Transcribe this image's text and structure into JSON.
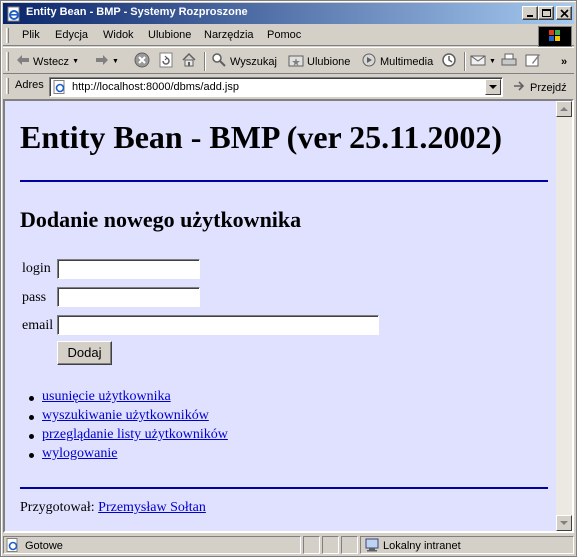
{
  "window": {
    "title": "Entity Bean - BMP - Systemy Rozproszone"
  },
  "menu": {
    "items": [
      {
        "label": "Plik"
      },
      {
        "label": "Edycja"
      },
      {
        "label": "Widok"
      },
      {
        "label": "Ulubione"
      },
      {
        "label": "Narzędzia"
      },
      {
        "label": "Pomoc"
      }
    ]
  },
  "toolbar": {
    "back_label": "Wstecz",
    "search_label": "Wyszukaj",
    "favorites_label": "Ulubione",
    "media_label": "Multimedia",
    "overflow": "»"
  },
  "address": {
    "label": "Adres",
    "url": "http://localhost:8000/dbms/add.jsp",
    "go_label": "Przejdź"
  },
  "page": {
    "heading": "Entity Bean - BMP (ver 25.11.2002)",
    "subheading": "Dodanie nowego użytkownika",
    "form": {
      "login_label": "login",
      "login_value": "",
      "pass_label": "pass",
      "pass_value": "",
      "email_label": "email",
      "email_value": "",
      "submit_label": "Dodaj"
    },
    "links": [
      {
        "label": "usunięcie użytkownika"
      },
      {
        "label": "wyszukiwanie użytkowników"
      },
      {
        "label": "przeglądanie listy użytkowników"
      },
      {
        "label": "wylogowanie"
      }
    ],
    "author_prefix": "Przygotował:",
    "author_name": "Przemysław Sołtan"
  },
  "status": {
    "text": "Gotowe",
    "zone": "Lokalny intranet"
  },
  "colors": {
    "page_background": "#e0e0ff",
    "rule": "#0000a0",
    "link": "#0000cc",
    "titlebar_start": "#0a246a",
    "titlebar_end": "#a6caf0"
  }
}
